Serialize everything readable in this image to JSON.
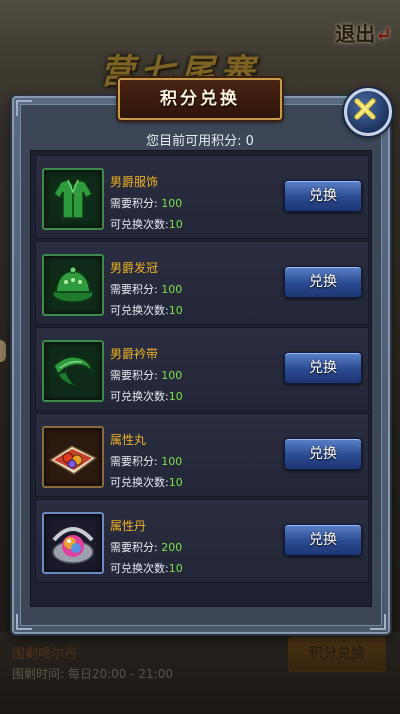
{
  "background": {
    "event_title": "营七尾寨",
    "exit_label": "退出",
    "event_name": "围剿喝尔丹",
    "event_time": "围剿时间:  每日20:00 - 21:00",
    "bottom_exchange_label": "积分兑换"
  },
  "dialog": {
    "title": "积分兑换",
    "points_label": "您目前可用积分:",
    "points_value": "0",
    "close_icon": "close-x-icon"
  },
  "labels": {
    "cost": "需要积分:",
    "times": "可兑换次数:",
    "exchange": "兑换"
  },
  "items": [
    {
      "name": "男爵服饰",
      "cost": "100",
      "times": "10",
      "icon": "green-robe-icon"
    },
    {
      "name": "男爵发冠",
      "cost": "100",
      "times": "10",
      "icon": "green-cap-icon"
    },
    {
      "name": "男爵衿带",
      "cost": "100",
      "times": "10",
      "icon": "green-sash-icon"
    },
    {
      "name": "属性丸",
      "cost": "100",
      "times": "10",
      "icon": "pills-on-cloth-icon"
    },
    {
      "name": "属性丹",
      "cost": "200",
      "times": "10",
      "icon": "orb-in-shell-icon"
    }
  ],
  "colors": {
    "item_name": "#f0b020",
    "value_green": "#7fe04a",
    "button_blue": "#2a4a90",
    "title_gold": "#c99a4a"
  }
}
